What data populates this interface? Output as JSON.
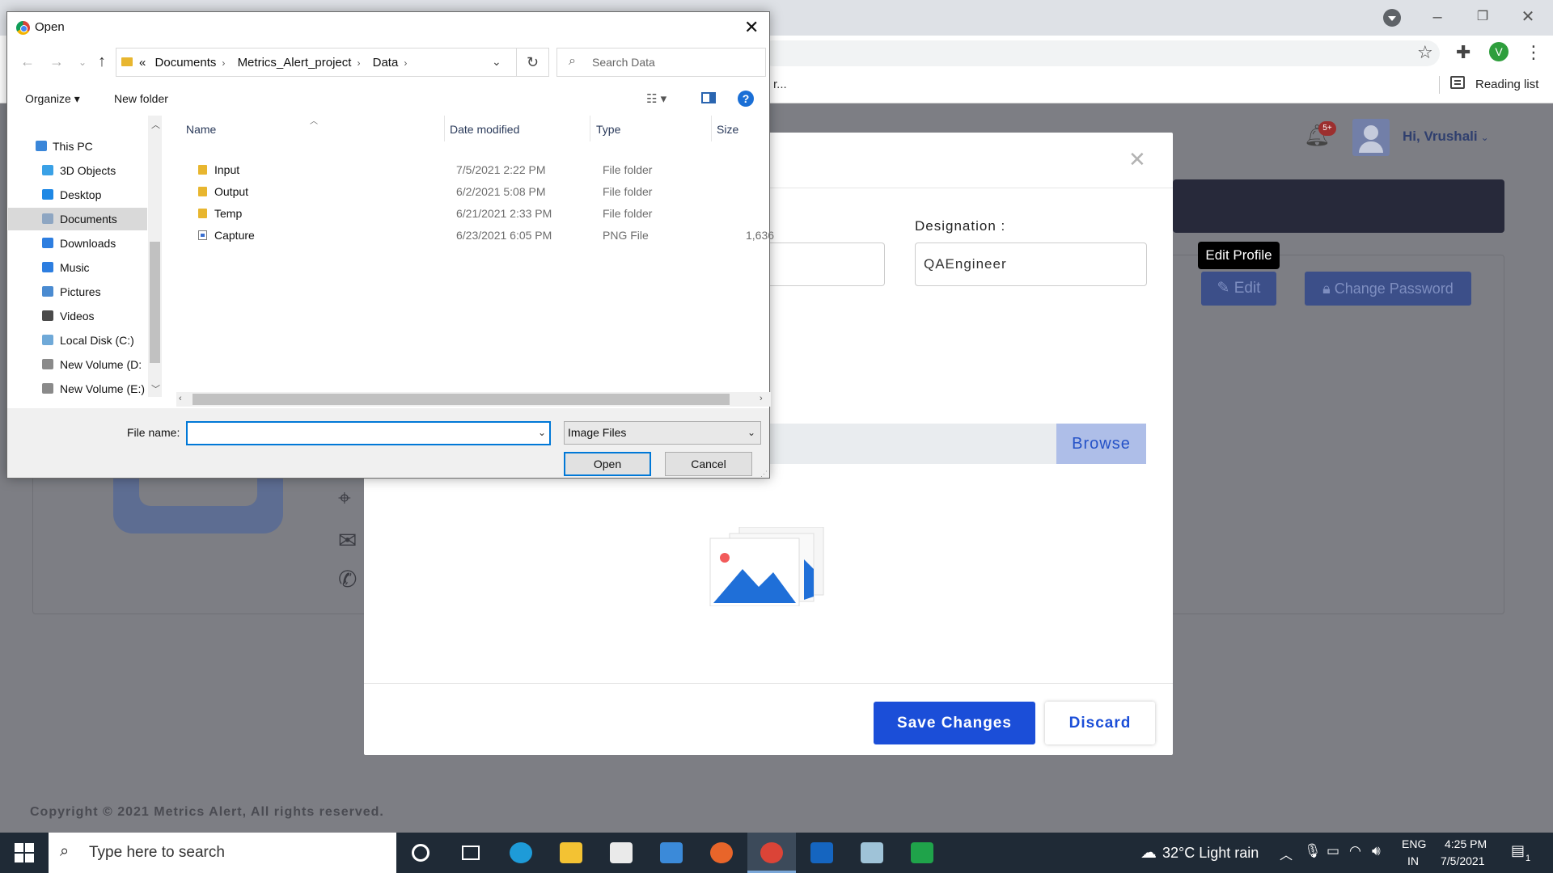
{
  "browser": {
    "bookmark_trunc": "r...",
    "reading_list": "Reading list",
    "profile_initial": "V"
  },
  "header": {
    "notification_badge": "5+",
    "greeting_prefix": "Hi, ",
    "user_name": "Vrushali"
  },
  "profile": {
    "edit_label": "Edit",
    "change_password_label": "Change Password",
    "tooltip": "Edit Profile"
  },
  "modal": {
    "designation_label": "Designation :",
    "designation_value": "QAEngineer",
    "browse_label": "Browse",
    "save_label": "Save Changes",
    "discard_label": "Discard"
  },
  "footer": {
    "copyright": "Copyright © 2021 Metrics Alert, All rights reserved."
  },
  "dialog": {
    "title": "Open",
    "breadcrumb_prefix": "«",
    "breadcrumb": [
      "Documents",
      "Metrics_Alert_project",
      "Data"
    ],
    "search_placeholder": "Search Data",
    "organize_label": "Organize",
    "new_folder_label": "New folder",
    "nav_tree": [
      {
        "label": "This PC",
        "icon": "pc-icon",
        "color": "#3a86d9"
      },
      {
        "label": "3D Objects",
        "icon": "cube-icon",
        "color": "#3aa1e6"
      },
      {
        "label": "Desktop",
        "icon": "desktop-icon",
        "color": "#1e88e5"
      },
      {
        "label": "Documents",
        "icon": "documents-icon",
        "color": "#8ea6c2",
        "selected": true
      },
      {
        "label": "Downloads",
        "icon": "download-arrow-icon",
        "color": "#2d7ee0"
      },
      {
        "label": "Music",
        "icon": "music-note-icon",
        "color": "#2d7ee0"
      },
      {
        "label": "Pictures",
        "icon": "pictures-icon",
        "color": "#4a8bd1"
      },
      {
        "label": "Videos",
        "icon": "film-icon",
        "color": "#4a4a4a"
      },
      {
        "label": "Local Disk (C:)",
        "icon": "disk-icon",
        "color": "#6fa9d8"
      },
      {
        "label": "New Volume (D:",
        "icon": "drive-icon",
        "color": "#8a8a8a"
      },
      {
        "label": "New Volume (E:)",
        "icon": "drive-icon",
        "color": "#8a8a8a"
      }
    ],
    "columns": [
      "Name",
      "Date modified",
      "Type",
      "Size"
    ],
    "files": [
      {
        "name": "Input",
        "date": "7/5/2021 2:22 PM",
        "type": "File folder",
        "size": "",
        "kind": "folder"
      },
      {
        "name": "Output",
        "date": "6/2/2021 5:08 PM",
        "type": "File folder",
        "size": "",
        "kind": "folder"
      },
      {
        "name": "Temp",
        "date": "6/21/2021 2:33 PM",
        "type": "File folder",
        "size": "",
        "kind": "folder"
      },
      {
        "name": "Capture",
        "date": "6/23/2021 6:05 PM",
        "type": "PNG File",
        "size": "1,636",
        "kind": "png"
      }
    ],
    "file_name_label": "File name:",
    "file_name_value": "",
    "file_type_value": "Image Files",
    "open_label": "Open",
    "cancel_label": "Cancel"
  },
  "taskbar": {
    "search_placeholder": "Type here to search",
    "weather": "32°C  Light rain",
    "lang_top": "ENG",
    "lang_bottom": "IN",
    "time": "4:25 PM",
    "date": "7/5/2021",
    "notification_count": "1",
    "apps": [
      {
        "name": "cortana-icon",
        "color": "#1f2a36"
      },
      {
        "name": "task-view-icon",
        "color": "#1f2a36"
      },
      {
        "name": "edge-icon",
        "color": "#1e9bd8"
      },
      {
        "name": "file-explorer-icon",
        "color": "#f3c233"
      },
      {
        "name": "store-icon",
        "color": "#eaeaea"
      },
      {
        "name": "mail-icon",
        "color": "#3b8ad9"
      },
      {
        "name": "firefox-icon",
        "color": "#e8652a"
      },
      {
        "name": "chrome-icon",
        "color": "#db4437",
        "active": true
      },
      {
        "name": "skype-s-icon",
        "color": "#1565c0"
      },
      {
        "name": "notepad-icon",
        "color": "#9fc3d8"
      },
      {
        "name": "media-player-icon",
        "color": "#1fa34a"
      }
    ]
  },
  "colors": {
    "accent_blue": "#1b4ed8",
    "overlay": "#7d7e84",
    "dialog_focus": "#0078d7"
  }
}
